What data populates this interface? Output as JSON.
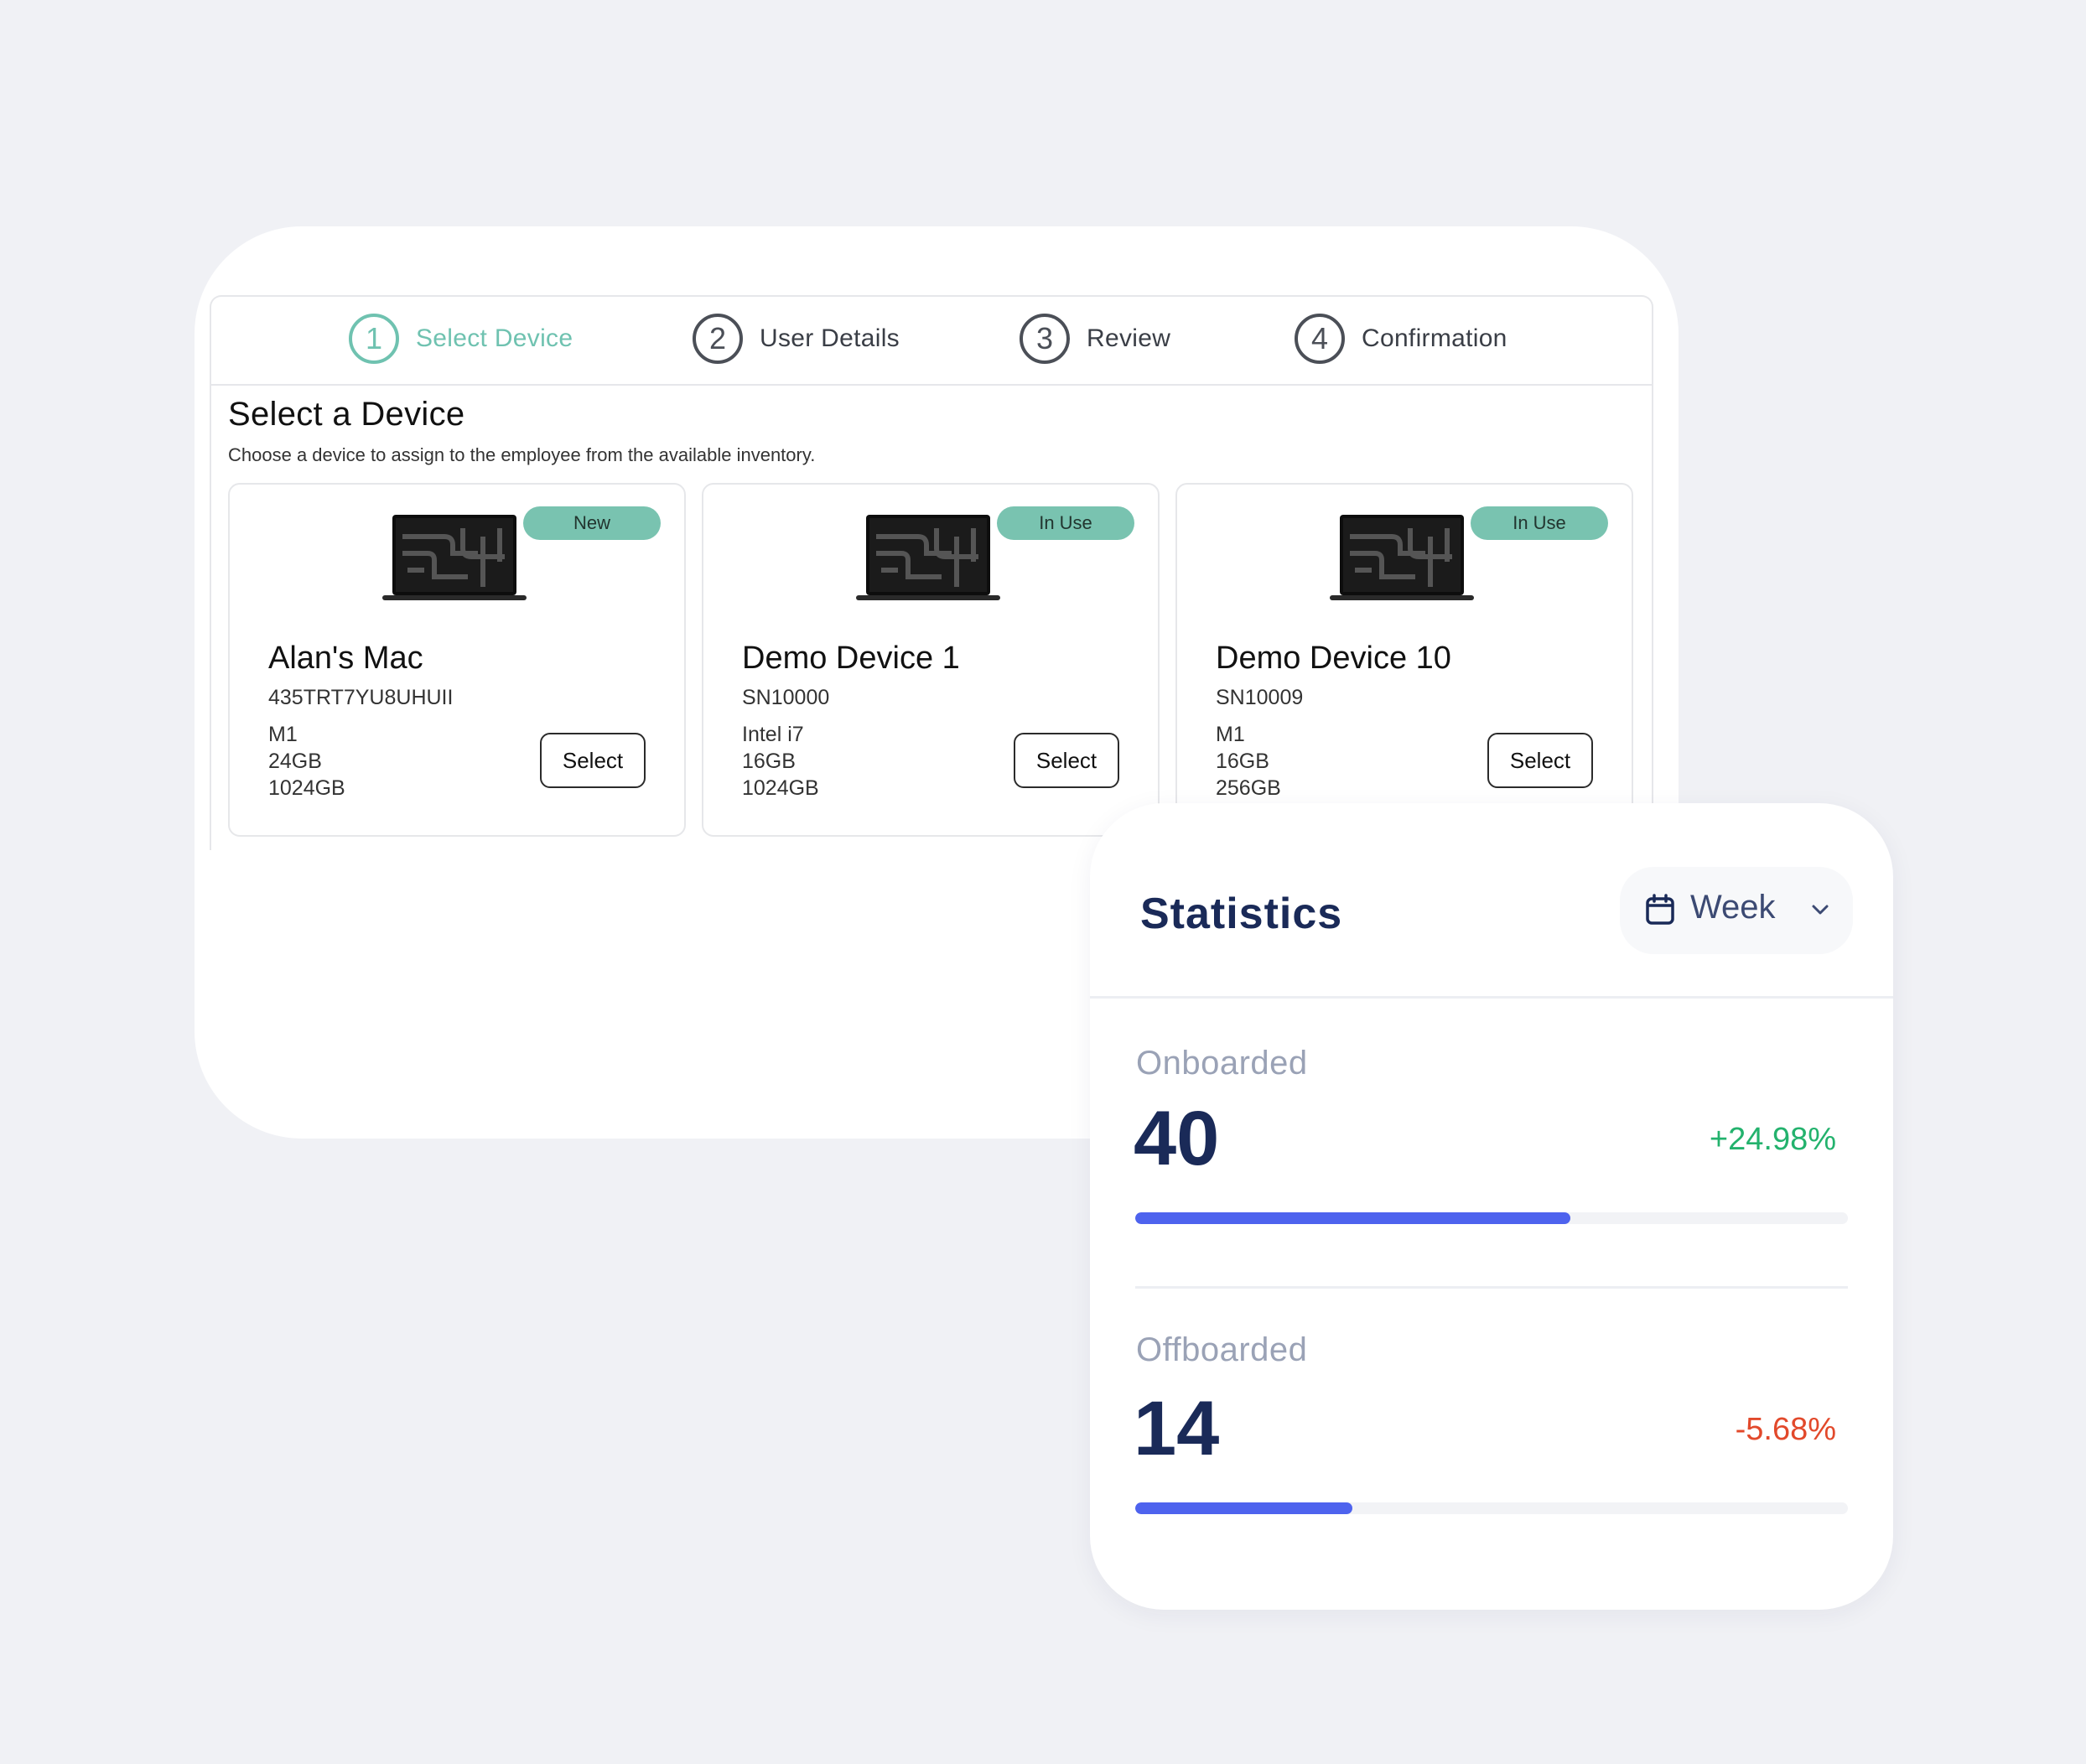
{
  "wizard": {
    "steps": [
      {
        "number": "1",
        "label": "Select Device",
        "active": true
      },
      {
        "number": "2",
        "label": "User Details",
        "active": false
      },
      {
        "number": "3",
        "label": "Review",
        "active": false
      },
      {
        "number": "4",
        "label": "Confirmation",
        "active": false
      }
    ],
    "title": "Select a Device",
    "subtitle": "Choose a device to assign to the employee from the available inventory.",
    "devices": [
      {
        "name": "Alan's Mac",
        "serial": "435TRT7YU8UHUII",
        "cpu": "M1",
        "ram": "24GB",
        "storage": "1024GB",
        "status": "New",
        "action": "Select"
      },
      {
        "name": "Demo Device 1",
        "serial": "SN10000",
        "cpu": "Intel i7",
        "ram": "16GB",
        "storage": "1024GB",
        "status": "In Use",
        "action": "Select"
      },
      {
        "name": "Demo Device 10",
        "serial": "SN10009",
        "cpu": "M1",
        "ram": "16GB",
        "storage": "256GB",
        "status": "In Use",
        "action": "Select"
      }
    ]
  },
  "statistics": {
    "title": "Statistics",
    "period": "Week",
    "metrics": [
      {
        "label": "Onboarded",
        "value": "40",
        "delta": "+24.98%",
        "trend": "up",
        "progress": 0.61
      },
      {
        "label": "Offboarded",
        "value": "14",
        "delta": "-5.68%",
        "trend": "down",
        "progress": 0.305
      }
    ]
  },
  "colors": {
    "accent": "#6fc2b0",
    "badge": "#79c3b0",
    "navy": "#1a2a58",
    "progress": "#4e63ee",
    "positive": "#23b26d",
    "negative": "#e2492b"
  },
  "icons": {
    "laptop": "laptop-icon",
    "calendar": "calendar-icon",
    "chevron": "chevron-down-icon"
  }
}
